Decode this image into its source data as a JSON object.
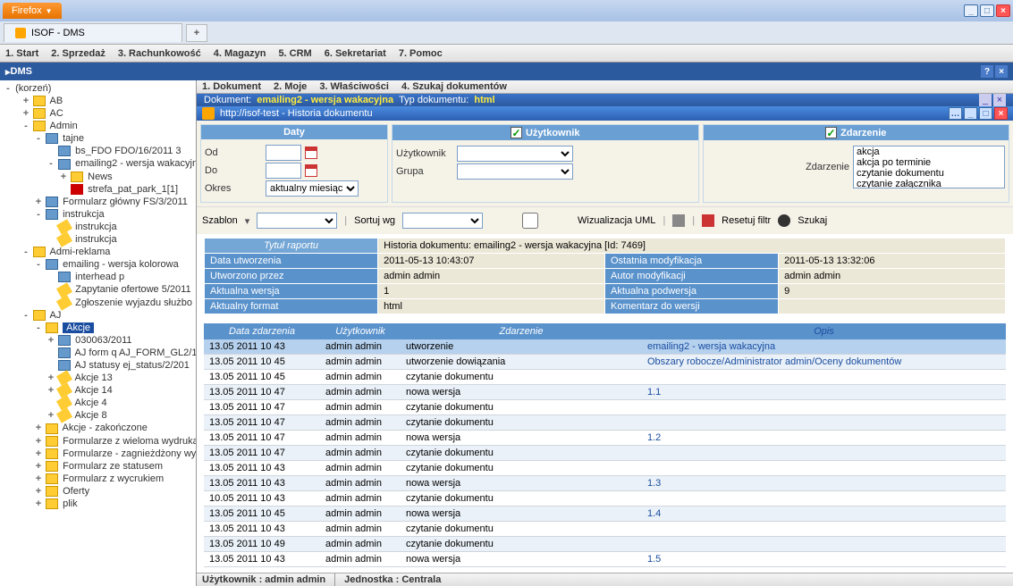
{
  "browser": {
    "name": "Firefox",
    "tab": "ISOF - DMS"
  },
  "menu": [
    "1. Start",
    "2. Sprzedaż",
    "3. Rachunkowość",
    "4. Magazyn",
    "5. CRM",
    "6. Sekretariat",
    "7. Pomoc"
  ],
  "module": "DMS",
  "tree": {
    "root": "(korzeń)",
    "items": [
      {
        "l": 1,
        "t": "+",
        "i": "f-y",
        "txt": "AB"
      },
      {
        "l": 1,
        "t": "+",
        "i": "f-y",
        "txt": "AC"
      },
      {
        "l": 1,
        "t": "-",
        "i": "f-y",
        "txt": "Admin"
      },
      {
        "l": 2,
        "t": "-",
        "i": "f-b",
        "txt": "tajne"
      },
      {
        "l": 3,
        "t": "",
        "i": "f-b",
        "txt": "bs_FDO FDO/16/2011 3"
      },
      {
        "l": 3,
        "t": "-",
        "i": "f-b",
        "txt": "emailing2 - wersja wakacyjna"
      },
      {
        "l": 4,
        "t": "+",
        "i": "f-y",
        "txt": "News"
      },
      {
        "l": 4,
        "t": "",
        "i": "f-r",
        "txt": "strefa_pat_park_1[1]"
      },
      {
        "l": 2,
        "t": "+",
        "i": "f-b",
        "txt": "Formularz główny FS/3/2011"
      },
      {
        "l": 2,
        "t": "-",
        "i": "f-b",
        "txt": "instrukcja"
      },
      {
        "l": 3,
        "t": "",
        "i": "f-pen",
        "txt": "instrukcja"
      },
      {
        "l": 3,
        "t": "",
        "i": "f-pen",
        "txt": "instrukcja"
      },
      {
        "l": 1,
        "t": "-",
        "i": "f-y",
        "txt": "Admi-reklama"
      },
      {
        "l": 2,
        "t": "-",
        "i": "f-b",
        "txt": "emailing - wersja kolorowa"
      },
      {
        "l": 3,
        "t": "",
        "i": "f-b",
        "txt": "interhead p"
      },
      {
        "l": 3,
        "t": "",
        "i": "f-pen",
        "txt": "Zapytanie ofertowe 5/2011"
      },
      {
        "l": 3,
        "t": "",
        "i": "f-pen",
        "txt": "Zgłoszenie wyjazdu służbo"
      },
      {
        "l": 1,
        "t": "-",
        "i": "f-y",
        "txt": "AJ"
      },
      {
        "l": 2,
        "t": "-",
        "i": "f-y",
        "txt": "Akcje",
        "sel": true
      },
      {
        "l": 3,
        "t": "+",
        "i": "f-b",
        "txt": "030063/2011"
      },
      {
        "l": 3,
        "t": "",
        "i": "f-b",
        "txt": "AJ form q AJ_FORM_GL2/1,"
      },
      {
        "l": 3,
        "t": "",
        "i": "f-b",
        "txt": "AJ statusy ej_status/2/201"
      },
      {
        "l": 3,
        "t": "+",
        "i": "f-pen",
        "txt": "Akcje 13"
      },
      {
        "l": 3,
        "t": "+",
        "i": "f-pen",
        "txt": "Akcje 14"
      },
      {
        "l": 3,
        "t": "",
        "i": "f-pen",
        "txt": "Akcje 4"
      },
      {
        "l": 3,
        "t": "+",
        "i": "f-pen",
        "txt": "Akcje 8"
      },
      {
        "l": 2,
        "t": "+",
        "i": "f-y",
        "txt": "Akcje - zakończone"
      },
      {
        "l": 2,
        "t": "+",
        "i": "f-y",
        "txt": "Formularze z wieloma wydruka"
      },
      {
        "l": 2,
        "t": "+",
        "i": "f-y",
        "txt": "Formularze - zagnieżdżony wyc"
      },
      {
        "l": 2,
        "t": "+",
        "i": "f-y",
        "txt": "Formularz ze statusem"
      },
      {
        "l": 2,
        "t": "+",
        "i": "f-y",
        "txt": "Formularz z wycrukiem"
      },
      {
        "l": 2,
        "t": "+",
        "i": "f-y",
        "txt": "Oferty"
      },
      {
        "l": 2,
        "t": "+",
        "i": "f-y",
        "txt": "plik"
      }
    ]
  },
  "docMenu": [
    "1. Dokument",
    "2. Moje",
    "3. Właściwości",
    "4. Szukaj dokumentów"
  ],
  "docInfo": {
    "label1": "Dokument:",
    "doc": "emailing2 - wersja wakacyjna",
    "label2": "Typ dokumentu:",
    "type": "html"
  },
  "hist": {
    "url": "http://isof-test - Historia dokumentu"
  },
  "filters": {
    "daty": "Daty",
    "od": "Od",
    "do": "Do",
    "okres": "Okres",
    "okresVal": "aktualny miesiąc",
    "uzyt": "Użytkownik",
    "uzytL": "Użytkownik",
    "grupa": "Grupa",
    "zd": "Zdarzenie",
    "zdL": "Zdarzenie",
    "opts": [
      "akcja",
      "akcja po terminie",
      "czytanie dokumentu",
      "czytanie załącznika"
    ]
  },
  "tbar": {
    "szablon": "Szablon",
    "sortuj": "Sortuj wg",
    "wiz": "Wizualizacja UML",
    "reset": "Resetuj filtr",
    "szukaj": "Szukaj"
  },
  "meta": {
    "title": "Tytuł raportu",
    "titleV": "Historia dokumentu: emailing2 - wersja wakacyjna [Id: 7469]",
    "r": [
      [
        "Data utworzenia",
        "2011-05-13 10:43:07",
        "Ostatnia modyfikacja",
        "2011-05-13 13:32:06"
      ],
      [
        "Utworzono przez",
        "admin admin",
        "Autor modyfikacji",
        "admin admin"
      ],
      [
        "Aktualna wersja",
        "1",
        "Aktualna podwersja",
        "9"
      ],
      [
        "Aktualny format",
        "html",
        "Komentarz do wersji",
        ""
      ]
    ]
  },
  "grid": {
    "hdr": [
      "Data zdarzenia",
      "Użytkownik",
      "Zdarzenie",
      "Opis"
    ],
    "rows": [
      [
        "13.05 2011 10 43",
        "admin admin",
        "utworzenie",
        "emailing2 - wersja wakacyjna"
      ],
      [
        "13.05 2011 10 45",
        "admin admin",
        "utworzenie dowiązania",
        "Obszary robocze/Administrator admin/Oceny dokumentów"
      ],
      [
        "13.05 2011 10 45",
        "admin admin",
        "czytanie dokumentu",
        ""
      ],
      [
        "13.05 2011 10 47",
        "admin admin",
        "nowa wersja",
        "1.1"
      ],
      [
        "13.05 2011 10 47",
        "admin admin",
        "czytanie dokumentu",
        ""
      ],
      [
        "13.05 2011 10 47",
        "admin admin",
        "czytanie dokumentu",
        ""
      ],
      [
        "13.05 2011 10 47",
        "admin admin",
        "nowa wersja",
        "1.2"
      ],
      [
        "13.05 2011 10 47",
        "admin admin",
        "czytanie dokumentu",
        ""
      ],
      [
        "13.05 2011 10 43",
        "admin admin",
        "czytanie dokumentu",
        ""
      ],
      [
        "13.05 2011 10 43",
        "admin admin",
        "nowa wersja",
        "1.3"
      ],
      [
        "10.05 2011 10 43",
        "admin admin",
        "czytanie dokumentu",
        ""
      ],
      [
        "13.05 2011 10 45",
        "admin admin",
        "nowa wersja",
        "1.4"
      ],
      [
        "13.05 2011 10 43",
        "admin admin",
        "czytanie dokumentu",
        ""
      ],
      [
        "13.05 2011 10 49",
        "admin admin",
        "czytanie dokumentu",
        ""
      ],
      [
        "13.05 2011 10 43",
        "admin admin",
        "nowa wersja",
        "1.5"
      ]
    ]
  },
  "status": {
    "user": "Użytkownik : admin admin",
    "unit": "Jednostka : Centrala"
  }
}
